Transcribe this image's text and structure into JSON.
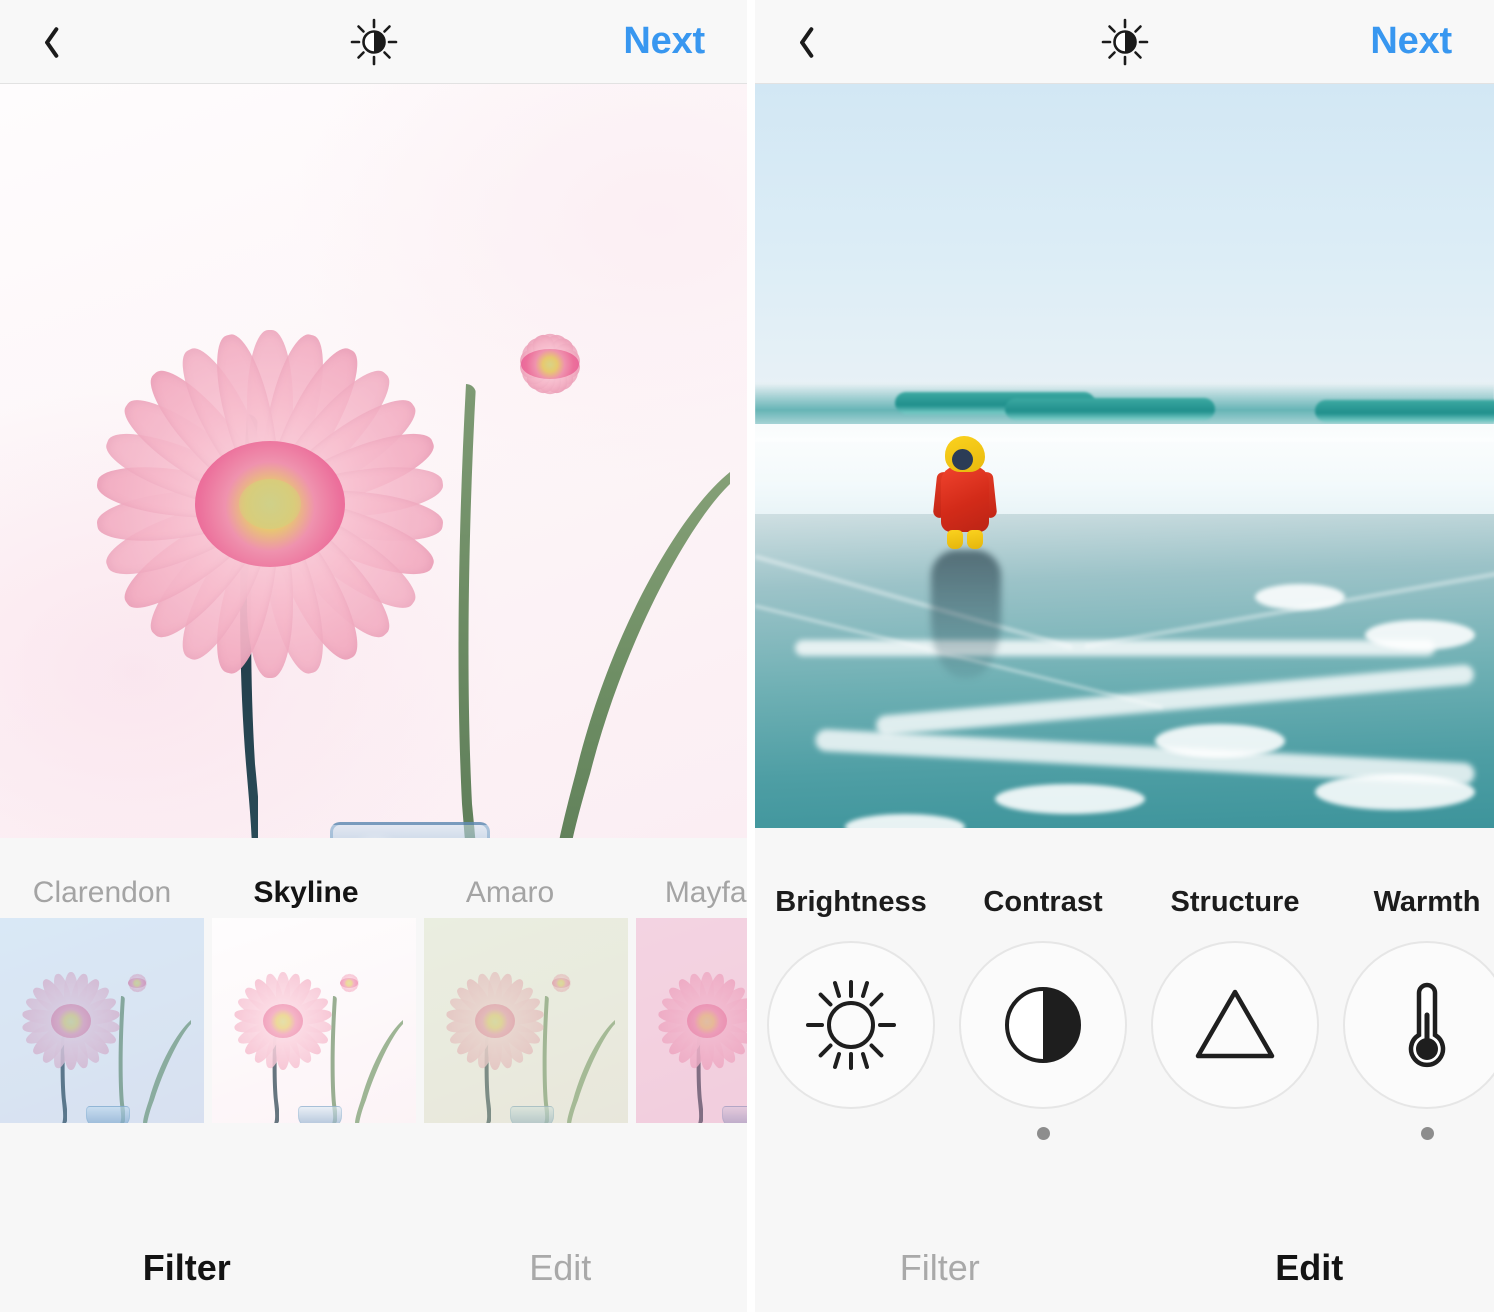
{
  "theme": {
    "accent_blue": "#3897f0",
    "panel_bg": "#f7f7f7",
    "header_bg": "#f8f8f8",
    "active_text": "#131313",
    "inactive_text": "#a9a9a9"
  },
  "left_panel": {
    "header": {
      "back_icon": "chevron-left-icon",
      "adjust_icon": "brightness-sun-icon",
      "next_label": "Next"
    },
    "photo": {
      "subject": "pink gerbera daisies in a glass vase",
      "filter_applied": "Skyline"
    },
    "filters": [
      {
        "name": "Clarendon",
        "selected": false,
        "tint": "rgba(168,205,235,0.42)"
      },
      {
        "name": "Skyline",
        "selected": true,
        "tint": "rgba(255,255,255,0.30)"
      },
      {
        "name": "Amaro",
        "selected": false,
        "tint": "rgba(214,224,196,0.50)"
      },
      {
        "name": "Mayfair",
        "selected": false,
        "tint": "rgba(232,168,196,0.48)"
      }
    ],
    "tabs": [
      {
        "label": "Filter",
        "active": true
      },
      {
        "label": "Edit",
        "active": false
      }
    ]
  },
  "right_panel": {
    "header": {
      "back_icon": "chevron-left-icon",
      "adjust_icon": "brightness-sun-icon",
      "next_label": "Next"
    },
    "photo": {
      "subject": "child in red snowsuit with yellow hood standing on a foggy beach"
    },
    "edit_tools": [
      {
        "label": "Brightness",
        "icon": "sun-icon",
        "adjusted": false
      },
      {
        "label": "Contrast",
        "icon": "half-circle-icon",
        "adjusted": true
      },
      {
        "label": "Structure",
        "icon": "triangle-icon",
        "adjusted": false
      },
      {
        "label": "Warmth",
        "icon": "thermometer-icon",
        "adjusted": true
      }
    ],
    "tabs": [
      {
        "label": "Filter",
        "active": false
      },
      {
        "label": "Edit",
        "active": true
      }
    ]
  }
}
